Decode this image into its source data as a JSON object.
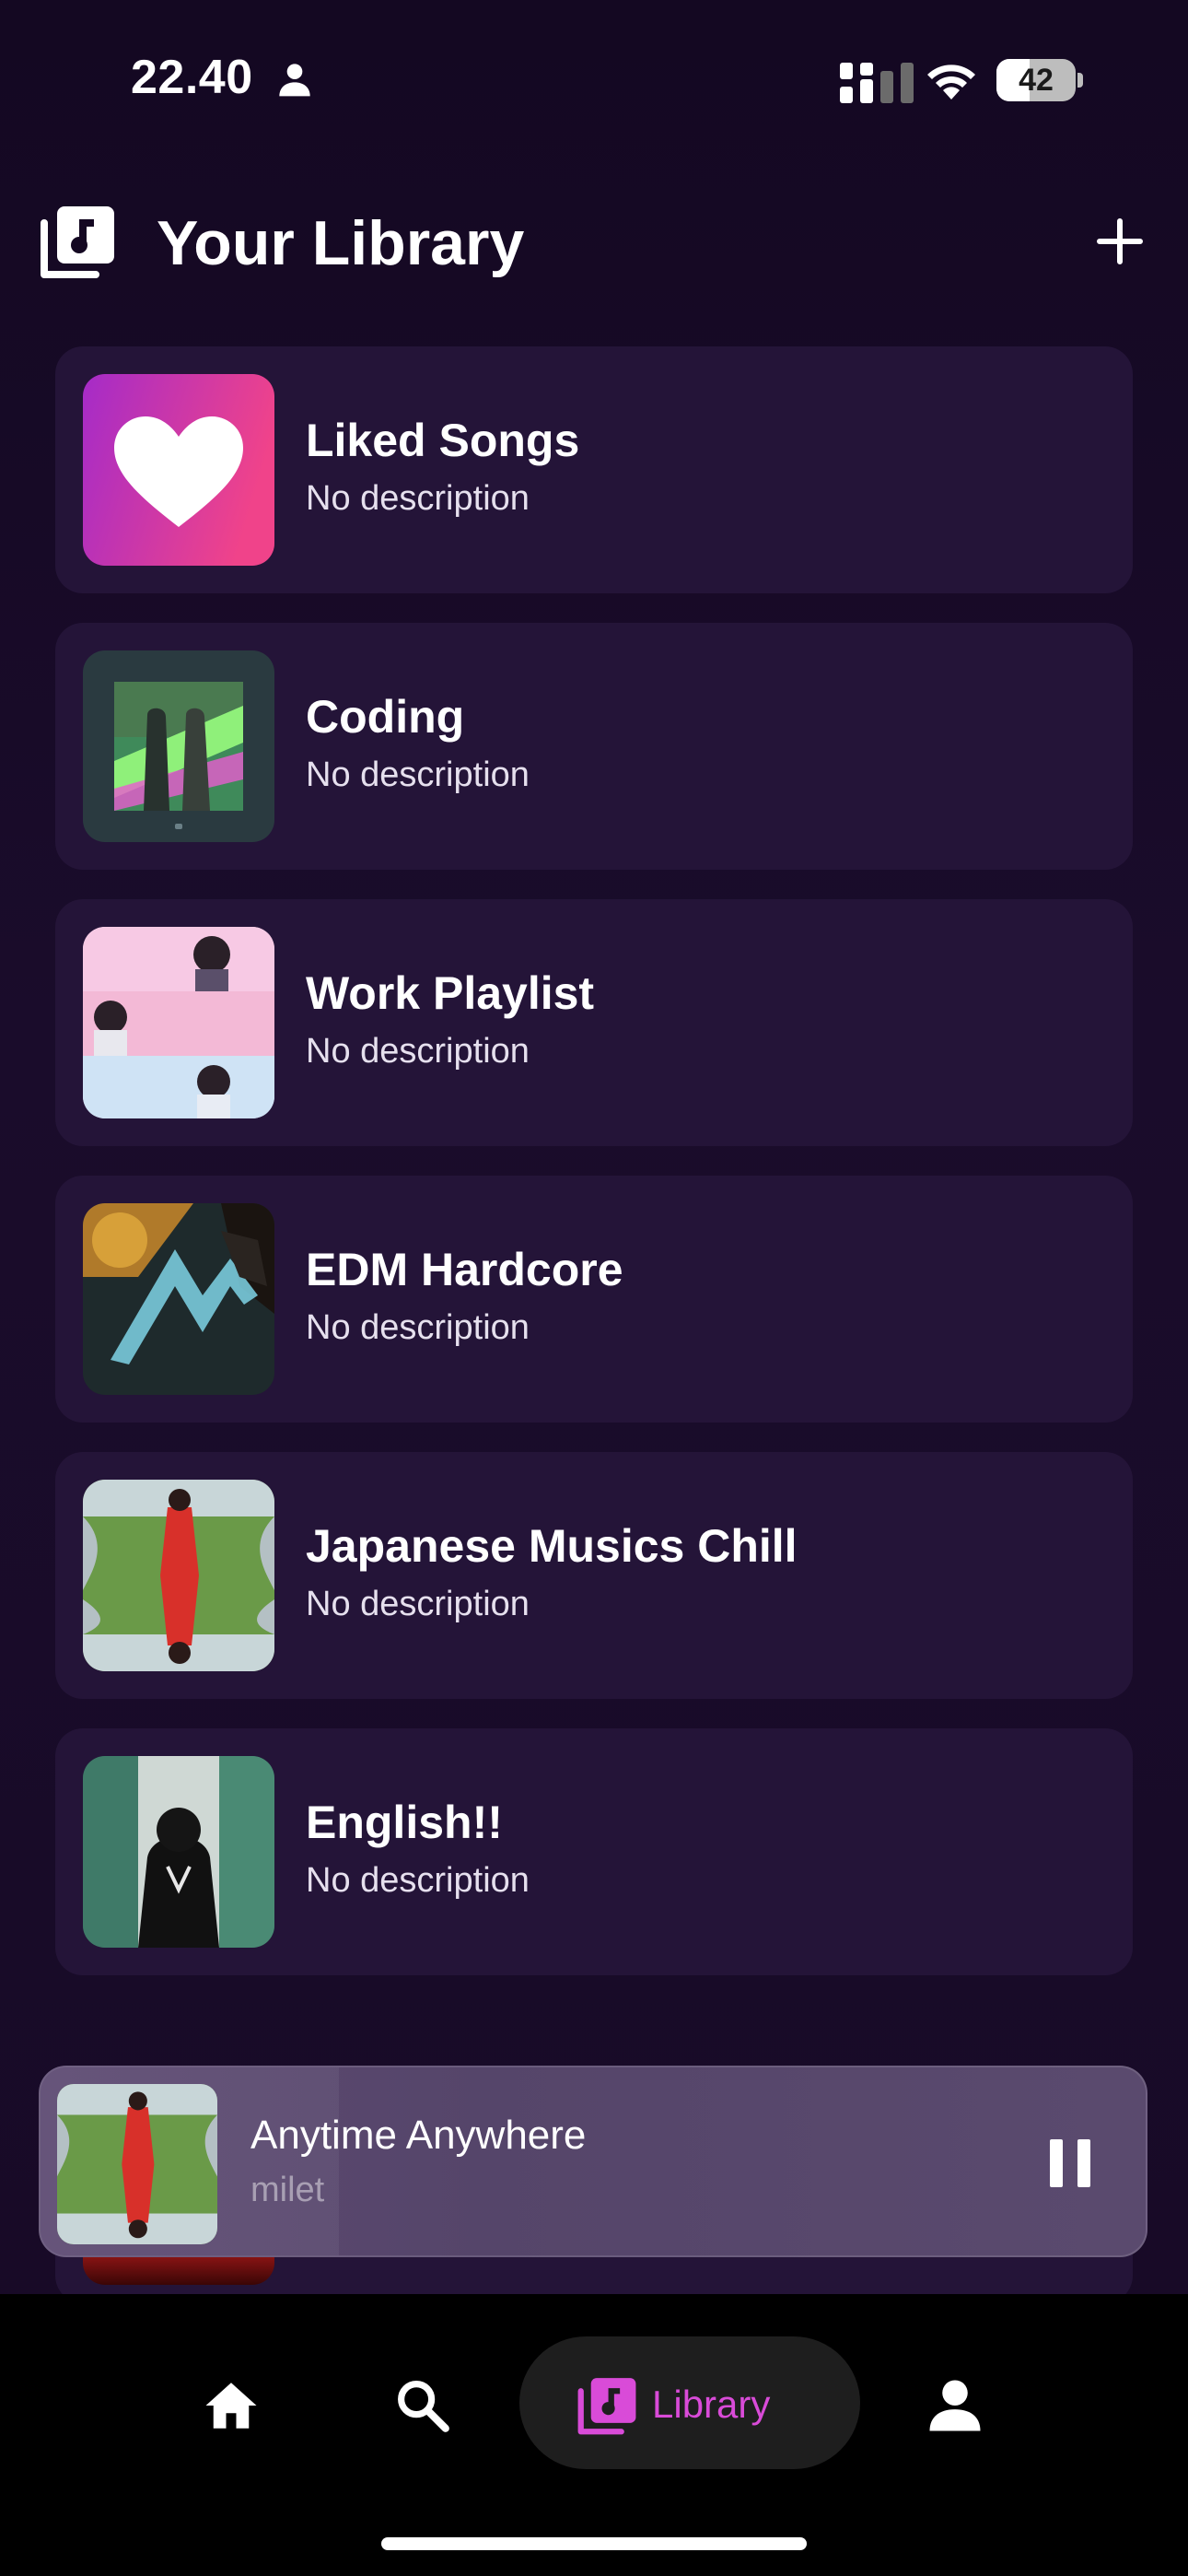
{
  "status_bar": {
    "time": "22.40",
    "battery_level": "42",
    "icons": [
      "person-icon",
      "cellular-signal-icon",
      "wifi-icon",
      "battery-icon"
    ]
  },
  "header": {
    "title": "Your Library",
    "icons": [
      "library-music-icon",
      "add-icon"
    ]
  },
  "playlists": [
    {
      "title": "Liked Songs",
      "description": "No description",
      "cover": "heart-icon"
    },
    {
      "title": "Coding",
      "description": "No description",
      "cover": "album-cover-coding"
    },
    {
      "title": "Work Playlist",
      "description": "No description",
      "cover": "album-cover-work"
    },
    {
      "title": "EDM Hardcore",
      "description": "No description",
      "cover": "album-cover-edm"
    },
    {
      "title": "Japanese Musics Chill",
      "description": "No description",
      "cover": "album-cover-japanese"
    },
    {
      "title": "English!!",
      "description": "No description",
      "cover": "album-cover-english"
    }
  ],
  "now_playing": {
    "title": "Anytime Anywhere",
    "artist": "milet",
    "progress": 0.27,
    "icon": "pause-icon"
  },
  "bottom_nav": {
    "items": [
      {
        "icon": "home-icon",
        "label": ""
      },
      {
        "icon": "search-icon",
        "label": ""
      },
      {
        "icon": "library-music-icon",
        "label": "Library",
        "active": true
      },
      {
        "icon": "profile-icon",
        "label": ""
      }
    ]
  },
  "colors": {
    "background": "#170a24",
    "card": "#241438",
    "accent": "#d94bd8",
    "liked_gradient_start": "#a52bc8",
    "liked_gradient_end": "#f0438a"
  }
}
